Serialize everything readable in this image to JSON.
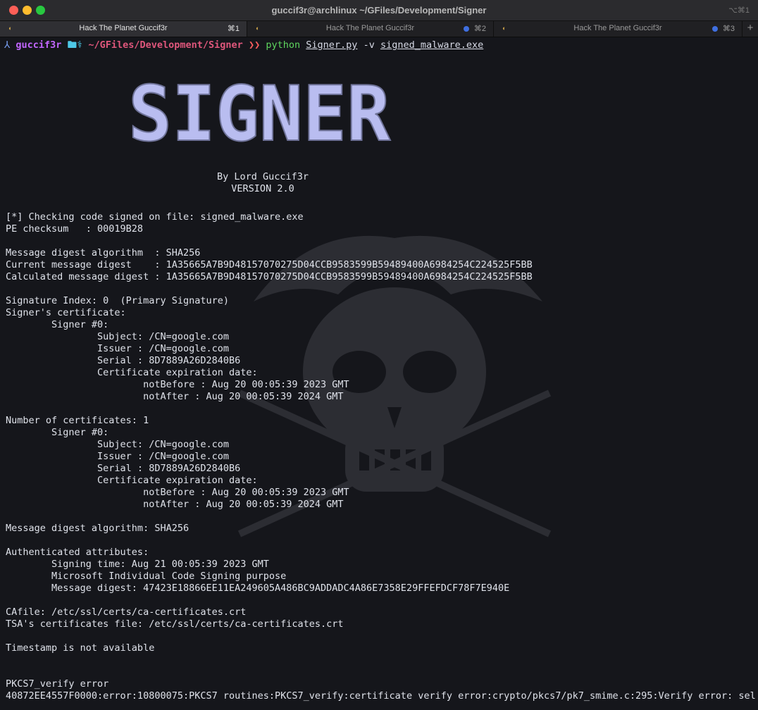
{
  "window": {
    "title": "guccif3r@archlinux ~/GFiles/Development/Signer",
    "shortcut": "⌥⌘1",
    "traffic_colors": {
      "close": "#fe5f57",
      "minimize": "#febc2e",
      "maximize": "#28c840"
    }
  },
  "tabs": [
    {
      "label": "Hack The Planet Guccif3r",
      "key": "⌘1",
      "active": true,
      "dot": false
    },
    {
      "label": "Hack The Planet Guccif3r",
      "key": "⌘2",
      "active": false,
      "dot": true
    },
    {
      "label": "Hack The Planet Guccif3r",
      "key": "⌘3",
      "active": false,
      "dot": true
    }
  ],
  "new_tab_label": "+",
  "prompt": {
    "arrow": "⅄",
    "user": "guccif3r",
    "icons": "🖿⚕",
    "path": "~/GFiles/Development/Signer",
    "separator": "❯❯",
    "command": "python",
    "script": "Signer.py",
    "flag": "-v",
    "target": "signed_malware.exe"
  },
  "banner": {
    "logo_text": "SIGNER",
    "credit_line1": "By Lord Guccif3r",
    "credit_line2": "VERSION 2.0"
  },
  "output": {
    "lines": [
      "[*] Checking code signed on file: signed_malware.exe",
      "PE checksum   : 00019B28",
      "",
      "Message digest algorithm  : SHA256",
      "Current message digest    : 1A35665A7B9D48157070275D04CCB9583599B59489400A6984254C224525F5BB",
      "Calculated message digest : 1A35665A7B9D48157070275D04CCB9583599B59489400A6984254C224525F5BB",
      "",
      "Signature Index: 0  (Primary Signature)",
      "Signer's certificate:",
      "        Signer #0:",
      "                Subject: /CN=google.com",
      "                Issuer : /CN=google.com",
      "                Serial : 8D7889A26D2840B6",
      "                Certificate expiration date:",
      "                        notBefore : Aug 20 00:05:39 2023 GMT",
      "                        notAfter : Aug 20 00:05:39 2024 GMT",
      "",
      "Number of certificates: 1",
      "        Signer #0:",
      "                Subject: /CN=google.com",
      "                Issuer : /CN=google.com",
      "                Serial : 8D7889A26D2840B6",
      "                Certificate expiration date:",
      "                        notBefore : Aug 20 00:05:39 2023 GMT",
      "                        notAfter : Aug 20 00:05:39 2024 GMT",
      "",
      "Message digest algorithm: SHA256",
      "",
      "Authenticated attributes:",
      "        Signing time: Aug 21 00:05:39 2023 GMT",
      "        Microsoft Individual Code Signing purpose",
      "        Message digest: 47423E18866EE11EA249605A486BC9ADDADC4A86E7358E29FFEFDCF78F7E940E",
      "",
      "CAfile: /etc/ssl/certs/ca-certificates.crt",
      "TSA's certificates file: /etc/ssl/certs/ca-certificates.crt",
      "",
      "Timestamp is not available",
      "",
      "",
      "PKCS7_verify error",
      "40872EE4557F0000:error:10800075:PKCS7 routines:PKCS7_verify:certificate verify error:crypto/pkcs7/pk7_smime.c:295:Verify error: sel"
    ]
  },
  "colors": {
    "background": "#15161b",
    "text": "#dfe2ea",
    "logo": "#b9bdf0",
    "user": "#c266ff",
    "path": "#e0577c",
    "command": "#5fd75f"
  }
}
